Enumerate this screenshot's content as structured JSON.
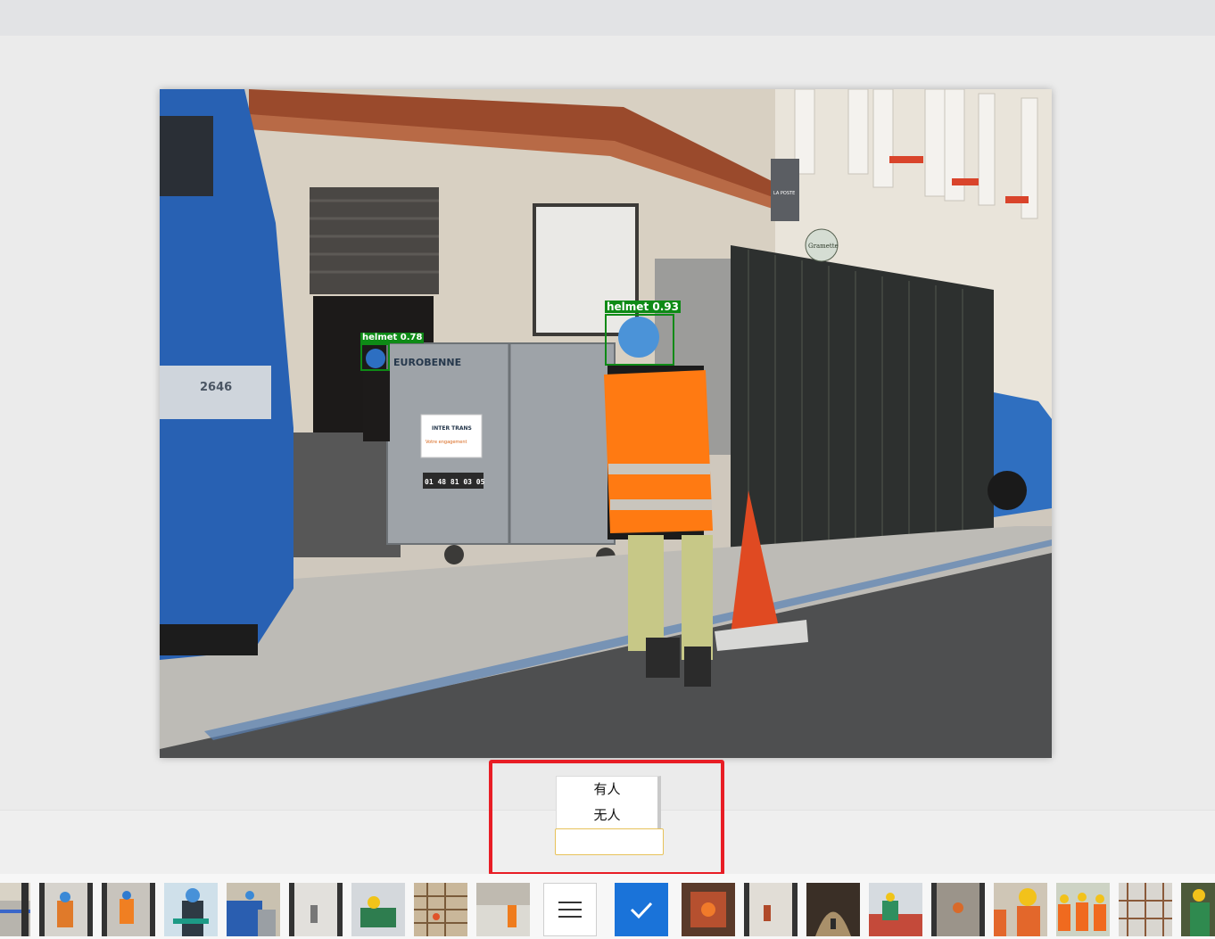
{
  "detections": [
    {
      "label": "helmet 0.78"
    },
    {
      "label": "helmet 0.93"
    }
  ],
  "photo_signs": {
    "container_brand": "EUROBENNE",
    "container_company": "INTER TRANS",
    "container_tagline": "Votre engagement",
    "container_phone": "01 48 81 03 05",
    "truck_model": "2646",
    "shop_sign": "Gramette",
    "post_sign": "LA POSTE"
  },
  "classifier": {
    "options": [
      "有人",
      "无人"
    ],
    "input_value": ""
  },
  "filmstrip": {
    "menu_icon": "hamburger-menu-icon",
    "check_icon": "checkmark-icon"
  },
  "colors": {
    "highlight_border": "#e81d25",
    "detection_box": "#0e8a16",
    "check_button": "#1a73d9",
    "input_border": "#e7c25a"
  }
}
